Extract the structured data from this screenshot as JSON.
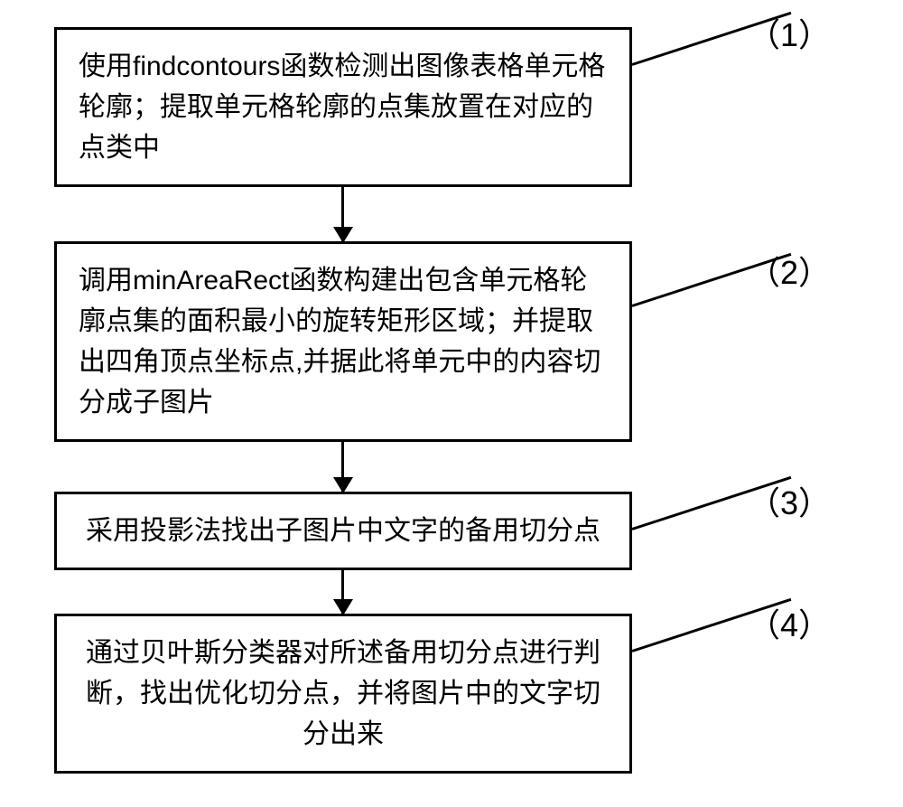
{
  "diagram": {
    "type": "flowchart",
    "direction": "top-to-bottom",
    "steps": [
      {
        "id": 1,
        "label": "（1）",
        "text": "使用findcontours函数检测出图像表格单元格轮廓；提取单元格轮廓的点集放置在对应的点类中"
      },
      {
        "id": 2,
        "label": "（2）",
        "text": "调用minAreaRect函数构建出包含单元格轮廓点集的面积最小的旋转矩形区域；并提取出四角顶点坐标点,并据此将单元中的内容切分成子图片"
      },
      {
        "id": 3,
        "label": "（3）",
        "text": "采用投影法找出子图片中文字的备用切分点"
      },
      {
        "id": 4,
        "label": "（4）",
        "text": "通过贝叶斯分类器对所述备用切分点进行判断，找出优化切分点，并将图片中的文字切分出来"
      }
    ]
  }
}
